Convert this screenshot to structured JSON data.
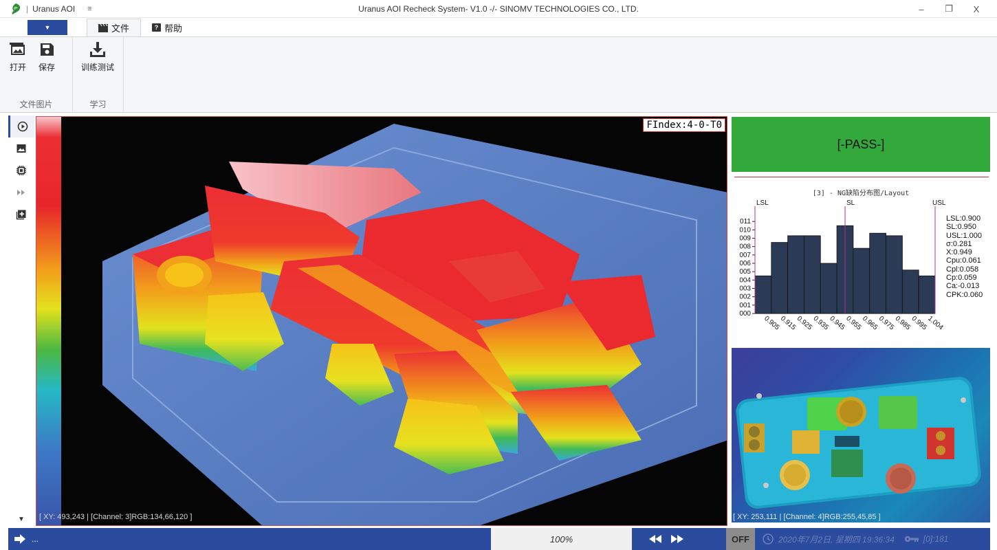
{
  "titlebar": {
    "app_name": "Uranus AOI",
    "separator": "|",
    "quick_access": "≡",
    "window_title": "Uranus AOI Recheck System- V1.0 -/- SINOMV TECHNOLOGIES CO., LTD.",
    "minimize": "–",
    "restore": "❐",
    "close": "X"
  },
  "ribbon": {
    "app_menu": "▼",
    "tabs": [
      {
        "label": "文件",
        "icon": "clapper-icon"
      },
      {
        "label": "帮助",
        "icon": "help-icon"
      }
    ],
    "groups": [
      {
        "label": "文件图片",
        "buttons": [
          {
            "label": "打开",
            "icon": "open-image-icon"
          },
          {
            "label": "保存",
            "icon": "save-icon"
          }
        ]
      },
      {
        "label": "学习",
        "buttons": [
          {
            "label": "训练测试",
            "icon": "download-icon"
          }
        ]
      }
    ]
  },
  "rail": {
    "icons": [
      "play-circle-icon",
      "image-icon",
      "chip-icon",
      "fast-forward-icon",
      "add-box-icon"
    ],
    "scroll_down": "▼"
  },
  "viewer": {
    "findex": "FIndex:4-0-T0",
    "readout": "[ XY: 493,243 | [Channel: 3]RGB:134,66,120 ]"
  },
  "result": {
    "status": "[-PASS-]",
    "color": "#33a93c"
  },
  "chart_data": {
    "type": "bar",
    "title": "[3] - NG缺陷分布图/Layout",
    "x_tick_labels": [
      "0.905",
      "0.915",
      "0.925",
      "0.935",
      "0.945",
      "0.955",
      "0.965",
      "0.975",
      "0.985",
      "0.995",
      "1.004"
    ],
    "y_tick_labels": [
      "000",
      "001",
      "002",
      "003",
      "004",
      "005",
      "006",
      "007",
      "008",
      "009",
      "010",
      "011"
    ],
    "values": [
      4.5,
      8.5,
      9.3,
      9.3,
      6.0,
      10.5,
      7.8,
      9.6,
      9.3,
      5.2,
      4.5
    ],
    "ylim": [
      0,
      12
    ],
    "xlim": [
      0.9,
      1.0
    ],
    "limit_lines": [
      {
        "label": "LSL",
        "x": 0.9
      },
      {
        "label": "SL",
        "x": 0.95
      },
      {
        "label": "USL",
        "x": 1.0
      }
    ],
    "bar_color": "#2b3a55",
    "limit_color": "#b0308c",
    "stats": [
      "LSL:0.900",
      "SL:0.950",
      "USL:1.000",
      "σ:0.281",
      "X:0.949",
      "Cpu:0.061",
      "Cpl:0.058",
      "Cp:0.059",
      "Ca:-0.013",
      "CPK:0.060"
    ]
  },
  "camera": {
    "readout": "[ XY: 253,111 | [Channel: 4]RGB:255,45,85 ]"
  },
  "statusbar": {
    "dots": "...",
    "zoom": "100%",
    "mode": "OFF",
    "datetime": "2020年7月2日, 星期四 19:36:34",
    "user": "[0]:181"
  },
  "colors": {
    "accent": "#2b4b9e",
    "pass": "#33a93c",
    "viewer_border": "#d24b4b"
  }
}
